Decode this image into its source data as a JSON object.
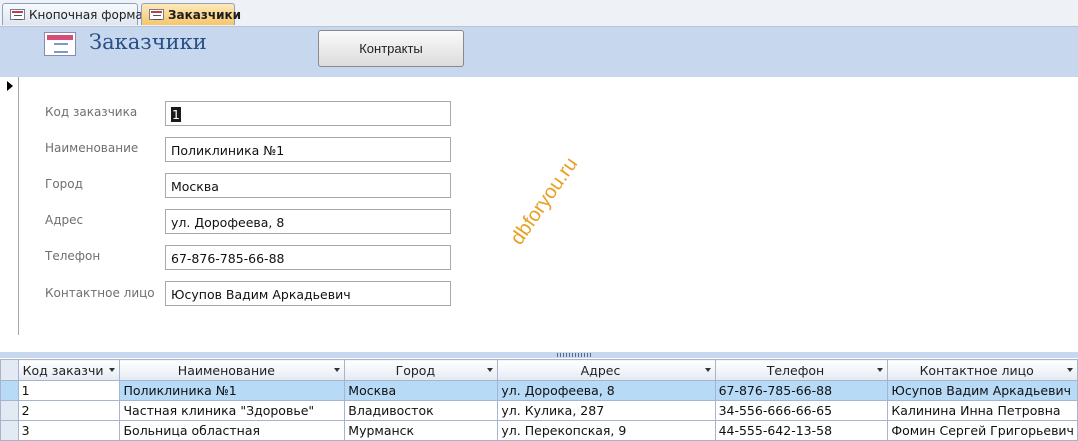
{
  "tabs": [
    {
      "label": "Кнопочная форма",
      "active": false
    },
    {
      "label": "Заказчики",
      "active": true
    }
  ],
  "header": {
    "title": "Заказчики",
    "contracts_button": "Контракты"
  },
  "form": {
    "fields": [
      {
        "label": "Код заказчика",
        "value": "1"
      },
      {
        "label": "Наименование",
        "value": "Поликлиника №1"
      },
      {
        "label": "Город",
        "value": "Москва"
      },
      {
        "label": "Адрес",
        "value": "ул. Дорофеева, 8"
      },
      {
        "label": "Телефон",
        "value": "67-876-785-66-88"
      },
      {
        "label": "Контактное лицо",
        "value": "Юсупов Вадим Аркадьевич"
      }
    ]
  },
  "watermark": "dbforyou.ru",
  "datasheet": {
    "columns": [
      "Код заказчи",
      "Наименование",
      "Город",
      "Адрес",
      "Телефон",
      "Контактное лицо"
    ],
    "rows": [
      [
        "1",
        "Поликлиника №1",
        "Москва",
        "ул. Дорофеева, 8",
        "67-876-785-66-88",
        "Юсупов Вадим Аркадьевич"
      ],
      [
        "2",
        "Частная клиника \"Здоровье\"",
        "Владивосток",
        "ул. Кулика, 287",
        "34-556-666-66-65",
        "Калинина Инна Петровна"
      ],
      [
        "3",
        "Больница областная",
        "Мурманск",
        "ул. Перекопская, 9",
        "44-555-642-13-58",
        "Фомин Сергей Григорьевич"
      ]
    ]
  }
}
